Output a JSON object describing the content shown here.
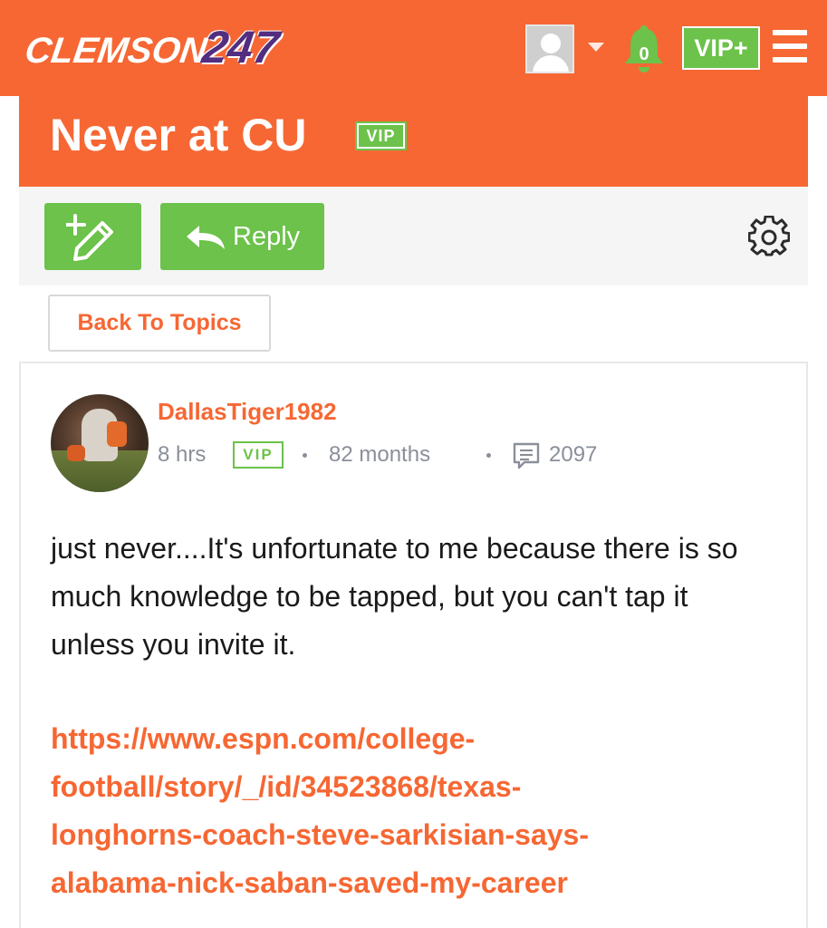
{
  "header": {
    "logo_brand": "CLEMSON",
    "logo_number": "247",
    "notification_count": "0",
    "vip_plus_label": "VIP+"
  },
  "topic": {
    "title": "Never at CU",
    "vip_badge": "VIP"
  },
  "toolbar": {
    "reply_label": "Reply"
  },
  "back_to_topics_label": "Back To Topics",
  "post": {
    "author": "DallasTiger1982",
    "time_ago": "8 hrs",
    "vip_badge": "VIP",
    "member_for": "82 months",
    "post_count": "2097",
    "body": "just never....It's unfortunate to me because there is so much knowledge to be tapped, but you can't tap it unless you invite it.",
    "link_lines": [
      "https://www.espn.com/college-",
      "football/story/_/id/34523868/texas-",
      "longhorns-coach-steve-sarkisian-says-",
      "alabama-nick-saban-saved-my-career"
    ]
  },
  "colors": {
    "brand_orange": "#f66733",
    "brand_purple": "#522d80",
    "vip_green": "#6cc24a",
    "meta_gray": "#8a8f99"
  },
  "icons": [
    "user-avatar-icon",
    "caret-down-icon",
    "bell-icon",
    "hamburger-icon",
    "new-post-icon",
    "reply-arrow-icon",
    "gear-icon",
    "comment-icon"
  ]
}
